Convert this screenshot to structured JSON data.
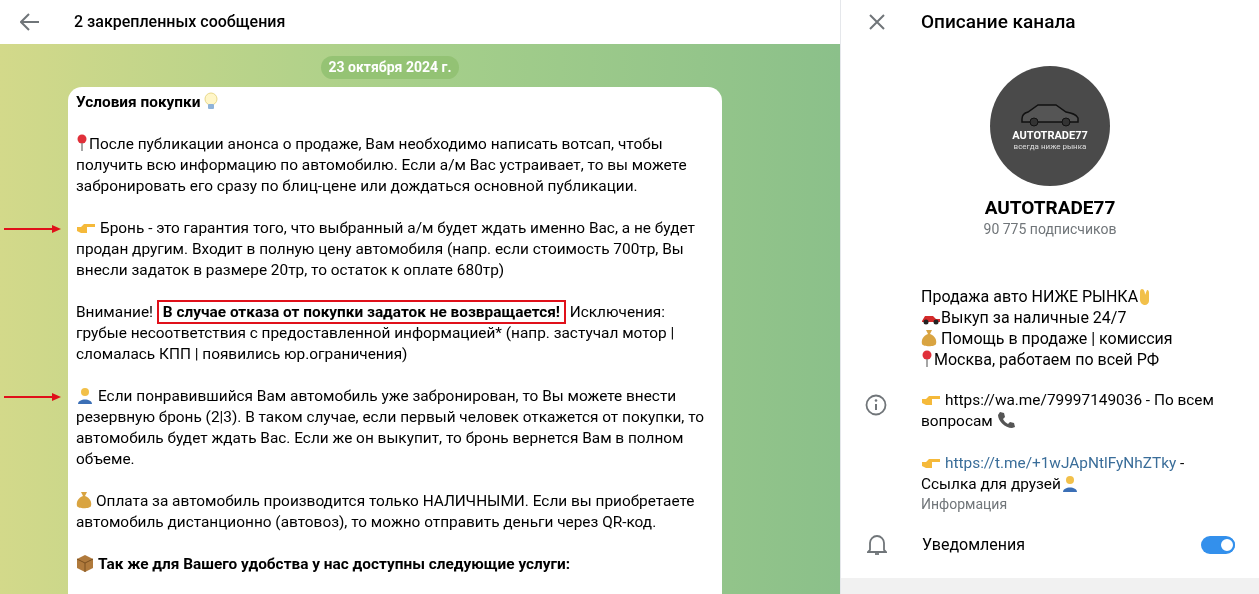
{
  "chat_header": {
    "title": "2 закрепленных сообщения"
  },
  "date_pill": "23 октября 2024 г.",
  "message": {
    "title": "Условия покупки",
    "paragraphs": [
      {
        "marked": false,
        "bold": false,
        "text": "После публикации анонса о продаже, Вам необходимо написать вотсап, чтобы получить всю информацию по автомобилю. Если а/м Вас устраивает, то вы можете забронировать его сразу по блиц-цене или дождаться основной публикации."
      },
      {
        "marked": true,
        "bold": false,
        "text": "Бронь - это гарантия того, что выбранный а/м будет ждать именно Вас, а не будет продан другим. Входит в полную цену автомобиля (напр. если стоимость 700тр, Вы внесли задаток в размере 20тр, то остаток к оплате 680тр)"
      },
      {
        "marked": false,
        "bold": false,
        "text": "Внимание!",
        "highlight": "В случае отказа от покупки задаток не возвращается!",
        "after": "Исключения: грубые несоответствия с предоставленной информацией* (напр. застучал мотор | сломалась КПП | появились юр.ограничения)"
      },
      {
        "marked": true,
        "bold": false,
        "text": "Если понравившийся Вам автомобиль уже забронирован, то Вы можете внести резервную бронь (2|3). В таком случае, если первый человек откажется от покупки, то автомобиль будет ждать Вас. Если же он выкупит, то бронь вернется Вам в полном объеме."
      },
      {
        "marked": false,
        "bold": false,
        "text": "Оплата за автомобиль производится только НАЛИЧНЫМИ. Если вы приобретаете автомобиль дистанционно (автовоз), то можно отправить деньги через QR-код."
      },
      {
        "marked": false,
        "bold": true,
        "text": "Так же для Вашего удобства у нас доступны следующие услуги:"
      }
    ]
  },
  "panel": {
    "title": "Описание канала",
    "avatar": {
      "brand": "AUTOTRADE77",
      "tagline": "всегда ниже рынка"
    },
    "name": "AUTOTRADE77",
    "subscribers": "90 775 подписчиков",
    "description": [
      "Продажа авто НИЖЕ РЫНКА",
      "Выкуп за наличные 24/7",
      "Помощь в продаже | комиссия",
      "Москва, работаем по всей РФ"
    ],
    "info": [
      {
        "link": false,
        "text": "https://wa.me/79997149036",
        "after": "- По всем вопросам"
      },
      {
        "link": true,
        "text": "https://t.me/+1wJApNtlFyNhZTky",
        "after": "- Ссылка для друзей"
      }
    ],
    "info_label": "Информация",
    "notifications": {
      "label": "Уведомления",
      "on": true
    }
  }
}
